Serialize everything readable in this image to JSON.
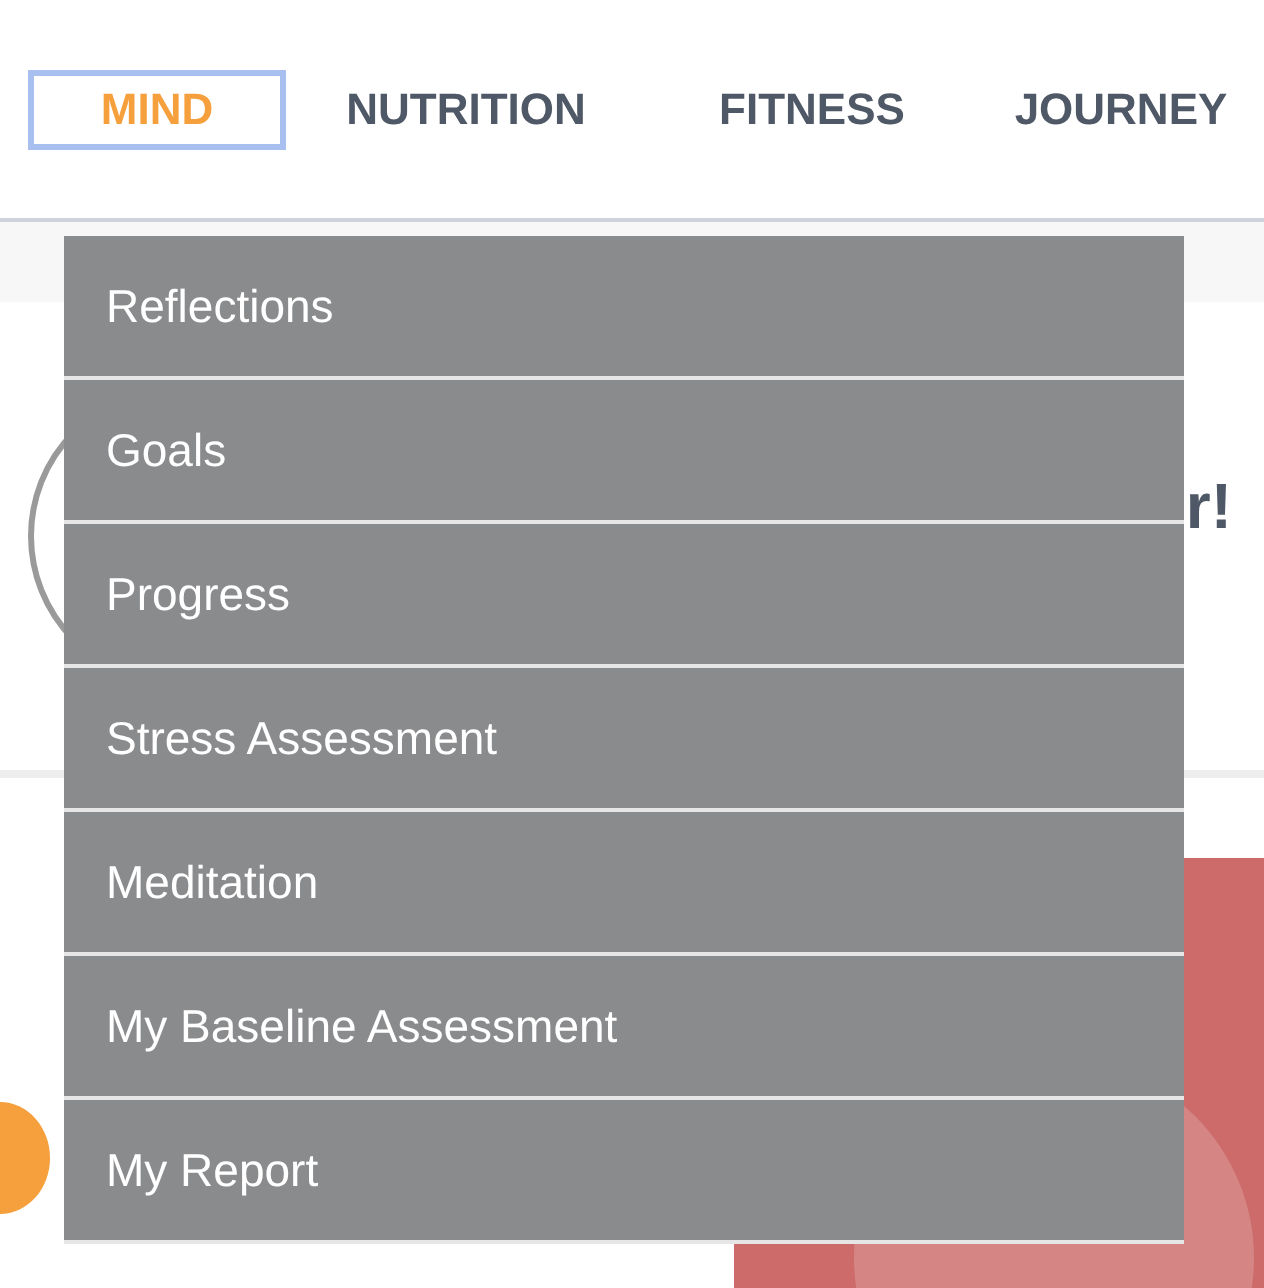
{
  "nav": {
    "tabs": [
      {
        "label": "MIND",
        "selected": true
      },
      {
        "label": "NUTRITION",
        "selected": false
      },
      {
        "label": "FITNESS",
        "selected": false
      },
      {
        "label": "JOURNEY",
        "selected": false
      }
    ]
  },
  "header": {
    "greeting": "r!"
  },
  "dropdown": {
    "items": [
      "Reflections",
      "Goals",
      "Progress",
      "Stress Assessment",
      "Meditation",
      "My Baseline Assessment",
      "My Report"
    ]
  }
}
